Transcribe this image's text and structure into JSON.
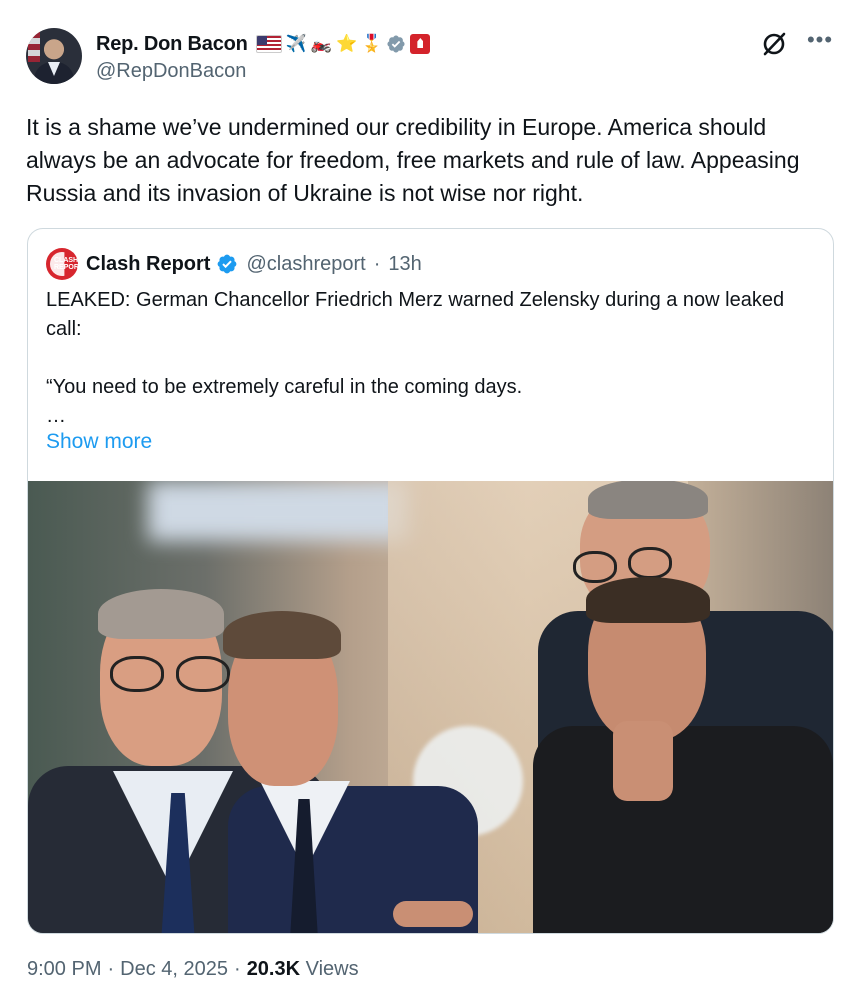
{
  "author": {
    "display_name": "Rep. Don Bacon",
    "handle": "@RepDonBacon",
    "name_icons": [
      "us-flag-icon",
      "airplane-icon",
      "motorcycle-icon",
      "star-icon",
      "medal-icon",
      "verified-gray-icon",
      "affiliate-label-icon"
    ],
    "emoji_airplane": "✈️",
    "emoji_motorcycle": "🏍️",
    "emoji_star": "⭐",
    "emoji_medal": "🎖️"
  },
  "tweet": {
    "text": "It is a shame we’ve undermined our credibility in Europe. America should always be an advocate for freedom, free markets and rule of law. Appeasing Russia and its invasion of Ukraine is not wise nor right."
  },
  "quote": {
    "display_name": "Clash Report",
    "handle": "@clashreport",
    "separator": "·",
    "time": "13h",
    "avatar_text": "CLASH REPORT",
    "text": "LEAKED: German Chancellor Friedrich Merz warned Zelensky during a now leaked call:\n\n“You need to be extremely careful in the coming days.\n…",
    "show_more": "Show more"
  },
  "meta": {
    "time": "9:00 PM",
    "sep1": "·",
    "date": "Dec 4, 2025",
    "sep2": "·",
    "views_count": "20.3K",
    "views_label": "Views"
  },
  "colors": {
    "accent": "#1d9bf0",
    "verified_blue": "#1d9bf0",
    "verified_gray": "#829aab",
    "secondary_text": "#536471",
    "label_red": "#d4232b"
  }
}
